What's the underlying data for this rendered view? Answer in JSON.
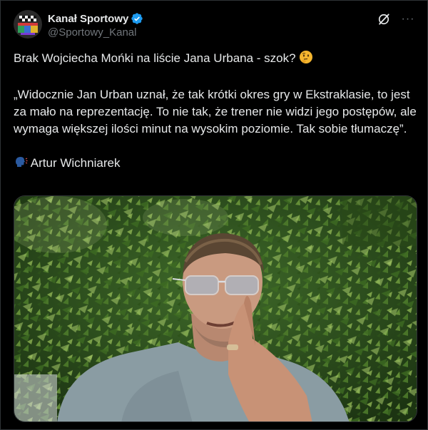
{
  "author": {
    "display_name": "Kanał Sportowy",
    "handle": "@Sportowy_Kanal",
    "verified": true,
    "avatar_icon": "kanal-sportowy-logo"
  },
  "actions": {
    "grok_icon": "grok-icon",
    "more_icon": "more-dots-icon",
    "more_label": "···"
  },
  "post": {
    "line1": "Brak Wojciecha Mońki na liście Jana Urbana - szok?",
    "line1_emoji": "thinking-face",
    "quote": "„Widocznie Jan Urban uznał, że tak krótki okres gry w Ekstraklasie, to jest za mało na reprezentację. To nie tak, że trener nie widzi jego postępów, ale wymaga większej ilości minut na wysokim poziomie. Tak sobie tłumaczę”.",
    "speaker_emoji": "speaking-head",
    "speaker": "Artur Wichniarek"
  },
  "media": {
    "type": "photo",
    "subject": "man-with-sunglasses-in-front-of-hedge"
  },
  "colors": {
    "background": "#000000",
    "text": "#e7e9ea",
    "secondary": "#71767b",
    "border": "#2f3336",
    "verified": "#1d9bf0"
  }
}
